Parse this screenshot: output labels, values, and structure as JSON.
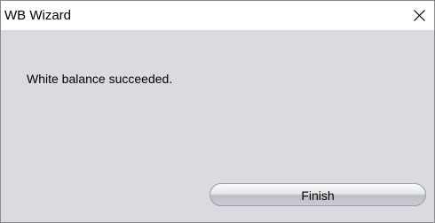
{
  "window": {
    "title": "WB Wizard",
    "close_icon": "close-icon"
  },
  "content": {
    "message": "White balance succeeded.",
    "finish_label": "Finish"
  },
  "colors": {
    "titlebar_bg": "#ffffff",
    "dialog_bg": "#d9dbe1"
  }
}
